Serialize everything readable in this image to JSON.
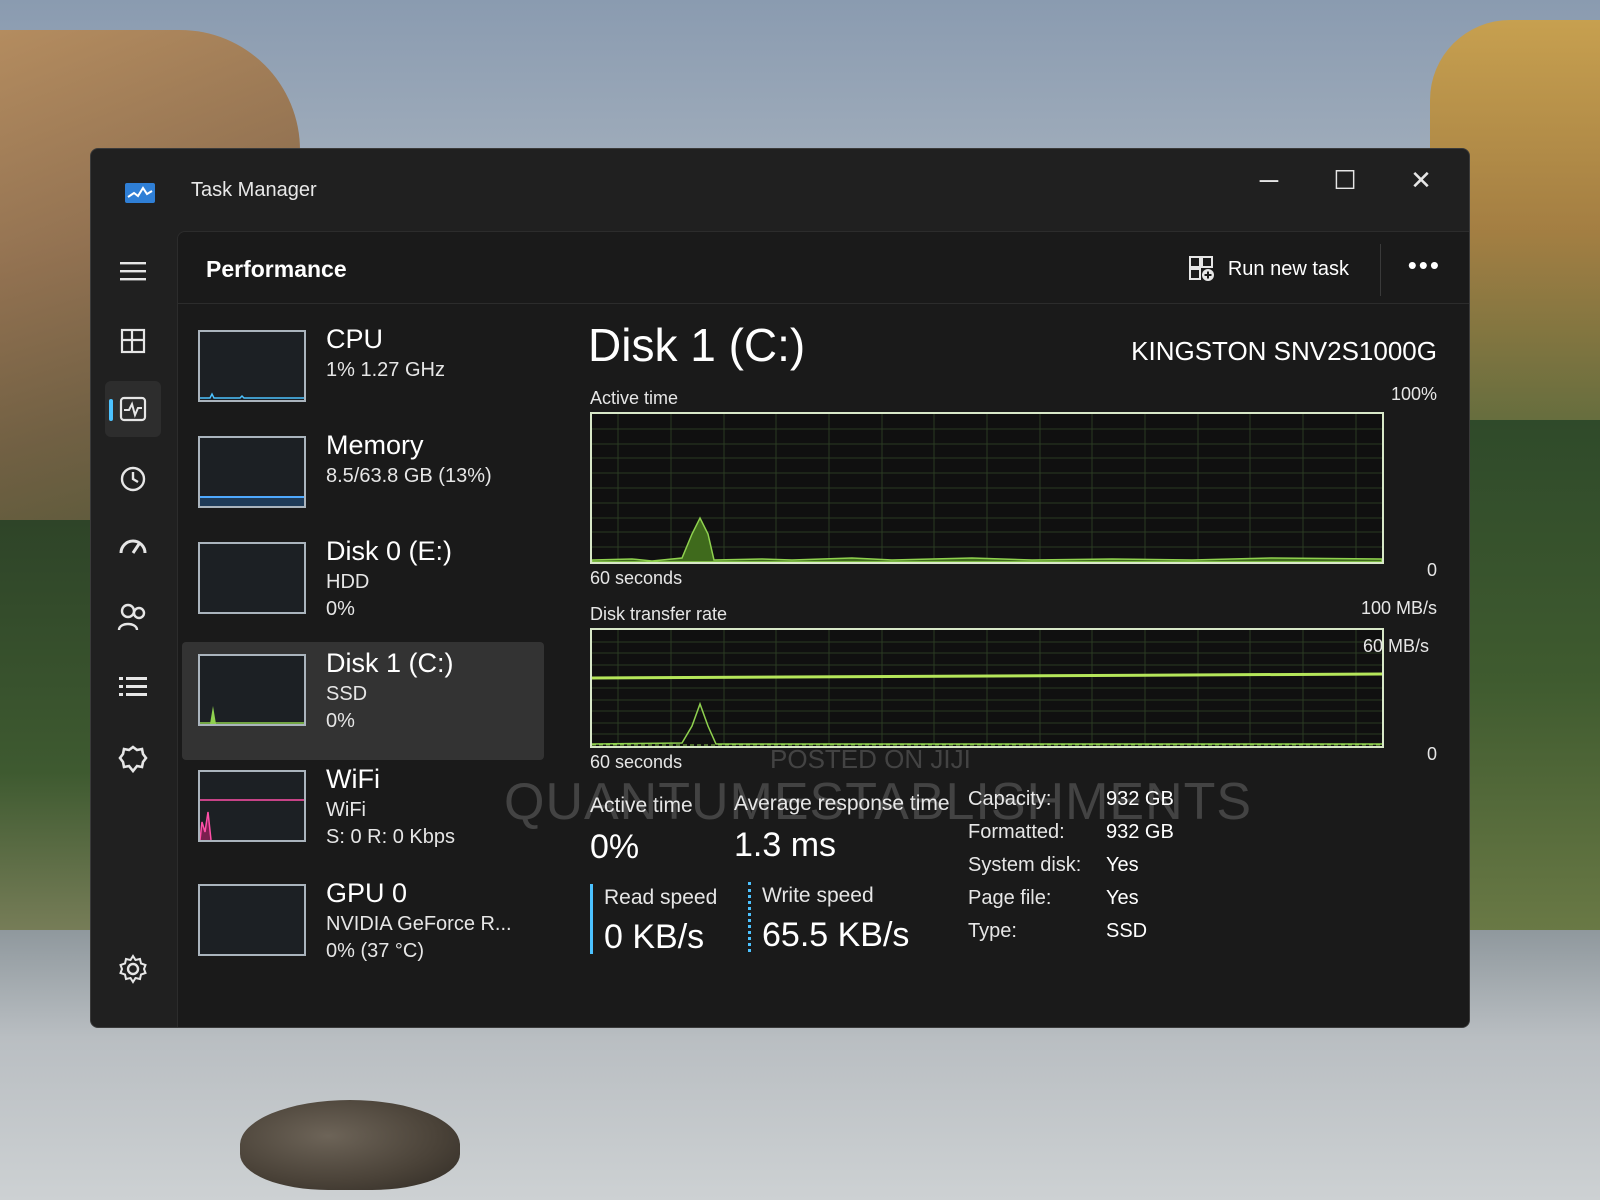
{
  "window": {
    "title": "Task Manager",
    "controls": {
      "minimize": "─",
      "maximize": "☐",
      "close": "✕"
    }
  },
  "nav": {
    "items": [
      {
        "icon": "hamburger-icon"
      },
      {
        "icon": "processes-icon"
      },
      {
        "icon": "performance-icon",
        "active": true
      },
      {
        "icon": "app-history-icon"
      },
      {
        "icon": "startup-apps-icon"
      },
      {
        "icon": "users-icon"
      },
      {
        "icon": "details-icon"
      },
      {
        "icon": "services-icon"
      },
      {
        "icon": "settings-icon"
      }
    ]
  },
  "header": {
    "page_title": "Performance",
    "run_new_task": "Run new task",
    "more": "•••"
  },
  "devices": [
    {
      "name": "CPU",
      "sub1": "1%  1.27 GHz",
      "sub2": "",
      "graph_color": "#4cc2ff"
    },
    {
      "name": "Memory",
      "sub1": "8.5/63.8 GB (13%)",
      "sub2": "",
      "graph_color": "#4ea9ff"
    },
    {
      "name": "Disk 0 (E:)",
      "sub1": "HDD",
      "sub2": "0%",
      "graph_color": "#8fd14f"
    },
    {
      "name": "Disk 1 (C:)",
      "sub1": "SSD",
      "sub2": "0%",
      "graph_color": "#8fd14f",
      "selected": true
    },
    {
      "name": "WiFi",
      "sub1": "WiFi",
      "sub2": "S: 0 R: 0 Kbps",
      "graph_color": "#ff4fa8"
    },
    {
      "name": "GPU 0",
      "sub1": "NVIDIA GeForce R...",
      "sub2": "0%  (37 °C)",
      "graph_color": "#4cc2ff"
    }
  ],
  "detail": {
    "title": "Disk 1 (C:)",
    "model": "KINGSTON SNV2S1000G",
    "active_graph": {
      "label": "Active time",
      "max": "100%",
      "min": "0",
      "duration": "60 seconds",
      "color": "#8fd14f"
    },
    "transfer_graph": {
      "label": "Disk transfer rate",
      "max": "100 MB/s",
      "line_label": "60 MB/s",
      "min": "0",
      "duration": "60 seconds",
      "color": "#8fd14f"
    },
    "stats": {
      "active_time_label": "Active time",
      "active_time_value": "0%",
      "avg_response_label": "Average response time",
      "avg_response_value": "1.3 ms",
      "read_label": "Read speed",
      "read_value": "0 KB/s",
      "write_label": "Write speed",
      "write_value": "65.5 KB/s"
    },
    "properties": [
      {
        "key": "Capacity:",
        "value": "932 GB"
      },
      {
        "key": "Formatted:",
        "value": "932 GB"
      },
      {
        "key": "System disk:",
        "value": "Yes"
      },
      {
        "key": "Page file:",
        "value": "Yes"
      },
      {
        "key": "Type:",
        "value": "SSD"
      }
    ]
  },
  "watermark": {
    "small": "POSTED ON JIJI",
    "big": "QUANTUMESTABLISHMENTS"
  }
}
